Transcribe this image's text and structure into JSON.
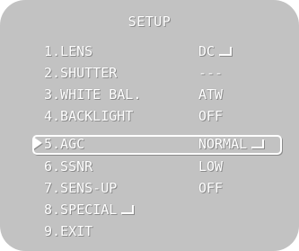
{
  "menu": {
    "title": "SETUP",
    "items": [
      {
        "label": "1.LENS",
        "value": "DC",
        "enter_icon": true
      },
      {
        "label": "2.SHUTTER",
        "value": "---",
        "enter_icon": false
      },
      {
        "label": "3.WHITE BAL.",
        "value": "ATW",
        "enter_icon": false
      },
      {
        "label": "4.BACKLIGHT",
        "value": "OFF",
        "enter_icon": false
      },
      {
        "label": "5.AGC",
        "value": "NORMAL",
        "enter_icon": true,
        "selected": true
      },
      {
        "label": "6.SSNR",
        "value": "LOW",
        "enter_icon": false
      },
      {
        "label": "7.SENS-UP",
        "value": "OFF",
        "enter_icon": false
      },
      {
        "label": "8.SPECIAL",
        "value": "",
        "enter_icon": true
      },
      {
        "label": "9.EXIT",
        "value": "",
        "enter_icon": false
      }
    ],
    "cursor_icon": "right-triangle-cursor-icon",
    "enter_icon": "enter-return-icon",
    "colors": {
      "background": "#c2c2c2",
      "text": "#ffffff",
      "text_shadow": "#8a8a8a"
    }
  }
}
